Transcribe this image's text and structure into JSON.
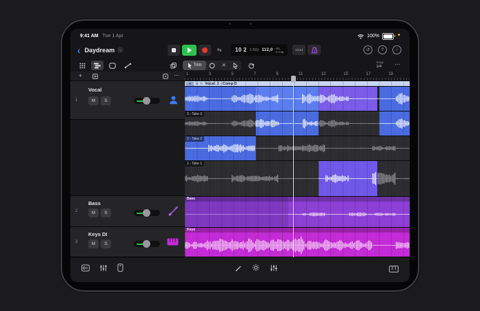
{
  "status": {
    "time": "9:41 AM",
    "date": "Tue 1 Apr",
    "battery_pct": "100%"
  },
  "header": {
    "title": "Daydream",
    "lcd": {
      "position_major": "10 2",
      "position_minor": "1 631",
      "tempo": "112,0",
      "time_sig": "4/4",
      "key": "C maj"
    },
    "count_in": "1234"
  },
  "toolbar": {
    "trim_label": "Trim",
    "snap_label": "Snap",
    "snap_value": "1/4"
  },
  "ruler": {
    "ticks": [
      "1",
      "3",
      "5",
      "7",
      "9",
      "11",
      "13",
      "15",
      "17",
      "19"
    ]
  },
  "tracks": [
    {
      "number": "1",
      "name": "Vocal",
      "mute": "M",
      "solo": "S"
    },
    {
      "number": "2",
      "name": "Bass",
      "mute": "M",
      "solo": "S"
    },
    {
      "number": "3",
      "name": "Keys DI",
      "mute": "M",
      "solo": "S"
    }
  ],
  "regions": {
    "comp": {
      "letter": "D",
      "label": "Vocal: 2 - Comp D"
    },
    "takes": [
      "3 - Take 3",
      "2 - Take 2",
      "1 - Take 1"
    ],
    "bass_label": "Bass",
    "keys_label": "Keys"
  },
  "glyphs": {
    "back": "‹",
    "dropdown": "⌄",
    "more": "⋯",
    "plus": "+",
    "chevron_down": "▾",
    "loop": "↻",
    "cycle": "⇆",
    "split": "✕",
    "help": "?",
    "minus": "−",
    "undo": "↺"
  },
  "colors": {
    "accent_blue": "#3d7bf5",
    "region_blue": "#4a6be0",
    "region_blue_light": "#5b7df0",
    "region_purple": "#7a5ce8",
    "take_purple": "#6f58e8",
    "bass_purple": "#8d3fd6",
    "keys_magenta": "#c32bd6",
    "play_green": "#2ec24e",
    "record_red": "#e53a30",
    "metronome_purple": "#a855e8"
  }
}
